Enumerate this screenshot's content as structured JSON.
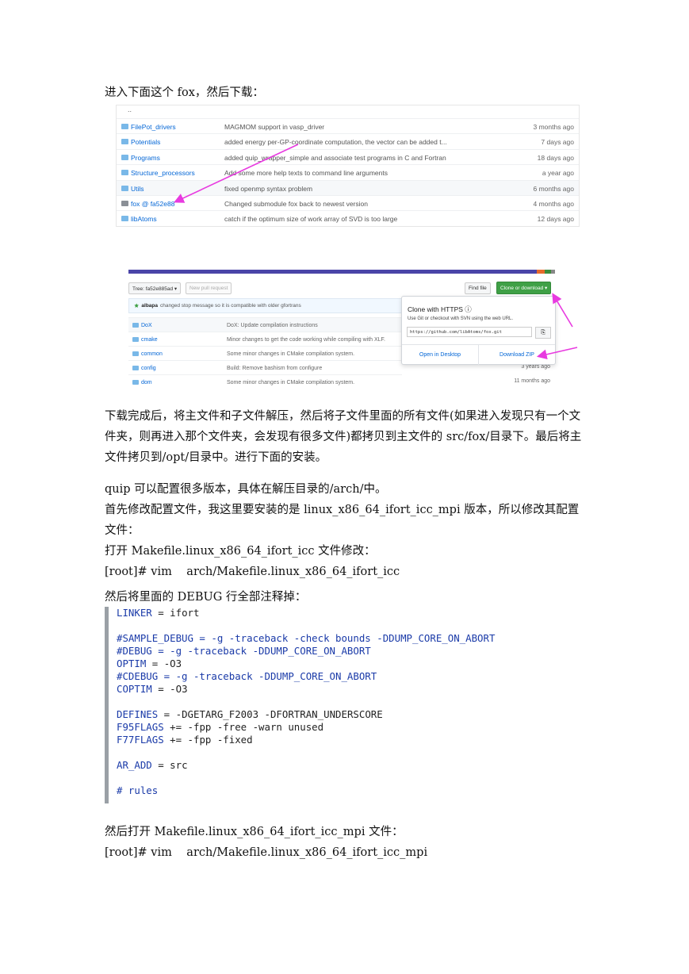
{
  "intro": "进入下面这个 fox，然后下载：",
  "file_list": {
    "parent": "..",
    "rows": [
      {
        "name": "FilePot_drivers",
        "message": "MAGMOM support in vasp_driver",
        "age": "3 months ago"
      },
      {
        "name": "Potentials",
        "message": "added energy per-GP-coordinate computation, the vector can be added t...",
        "age": "7 days ago"
      },
      {
        "name": "Programs",
        "message": "added quip_wrapper_simple and associate test programs in C and Fortran",
        "age": "18 days ago"
      },
      {
        "name": "Structure_processors",
        "message": "Add some more help texts to command line arguments",
        "age": "a year ago"
      },
      {
        "name": "Utils",
        "message": "fixed openmp syntax problem",
        "age": "6 months ago"
      },
      {
        "name": "fox @ fa52e88",
        "message": "Changed submodule fox back to newest version",
        "age": "4 months ago"
      },
      {
        "name": "libAtoms",
        "message": "catch if the optimum size of work array of SVD is too large",
        "age": "12 days ago"
      }
    ]
  },
  "repo": {
    "tree_button": "Tree: fa52e885ad ▾",
    "pull_button": "New pull request",
    "find_button": "Find file",
    "clone_button": "Clone or download ▾",
    "commit_user": "albapa",
    "commit_message": "changed stop message so it is compatible with older gfortrans",
    "rows": [
      {
        "name": "DoX",
        "message": "DoX: Update compilation instructions"
      },
      {
        "name": "cmake",
        "message": "Minor changes to get the code working while compiling with XLF."
      },
      {
        "name": "common",
        "message": "Some minor changes in CMake compilation system."
      },
      {
        "name": "config",
        "message": "Build: Remove bashism from configure"
      },
      {
        "name": "dom",
        "message": "Some minor changes in CMake compilation system."
      }
    ],
    "ages": [
      "3 years ago",
      "11 months ago"
    ],
    "popup": {
      "title": "Clone with HTTPS ⓘ",
      "subtitle": "Use Git or checkout with SVN using the web URL.",
      "url": "https://github.com/libAtoms/fox.git",
      "open_desktop": "Open in Desktop",
      "download_zip": "Download ZIP"
    }
  },
  "paragraph2": "下载完成后，将主文件和子文件解压，然后将子文件里面的所有文件(如果进入发现只有一个文件夹，则再进入那个文件夹，会发现有很多文件)都拷贝到主文件的 src/fox/目录下。最后将主文件拷贝到/opt/目录中。进行下面的安装。",
  "lines": [
    "quip 可以配置很多版本，具体在解压目录的/arch/中。",
    "首先修改配置文件，我这里要安装的是 linux_x86_64_ifort_icc_mpi 版本，所以修改其配置文件：",
    "打开 Makefile.linux_x86_64_ifort_icc 文件修改：",
    "[root]# vim    arch/Makefile.linux_x86_64_ifort_icc"
  ],
  "line_before_code": "然后将里面的 DEBUG 行全部注释掉：",
  "code_lines": [
    {
      "k": "LINKER",
      "o": " = ",
      "v": "ifort"
    },
    {
      "k": "",
      "o": "",
      "v": ""
    },
    {
      "k": "#SAMPLE_DEBUG = -g -traceback -check bounds -DDUMP_CORE_ON_ABORT",
      "o": "",
      "v": ""
    },
    {
      "k": "#DEBUG = -g -traceback -DDUMP_CORE_ON_ABORT",
      "o": "",
      "v": ""
    },
    {
      "k": "OPTIM",
      "o": " = ",
      "v": "-O3"
    },
    {
      "k": "#CDEBUG = -g -traceback -DDUMP_CORE_ON_ABORT",
      "o": "",
      "v": ""
    },
    {
      "k": "COPTIM",
      "o": " = ",
      "v": "-O3"
    },
    {
      "k": "",
      "o": "",
      "v": ""
    },
    {
      "k": "DEFINES",
      "o": " = ",
      "v": "-DGETARG_F2003 -DFORTRAN_UNDERSCORE"
    },
    {
      "k": "F95FLAGS",
      "o": " += ",
      "v": "-fpp -free -warn unused"
    },
    {
      "k": "F77FLAGS",
      "o": " += ",
      "v": "-fpp -fixed"
    },
    {
      "k": "",
      "o": "",
      "v": ""
    },
    {
      "k": "AR_ADD",
      "o": " = ",
      "v": "src"
    },
    {
      "k": "",
      "o": "",
      "v": ""
    },
    {
      "k": "# rules",
      "o": "",
      "v": ""
    }
  ],
  "end_lines": [
    "然后打开 Makefile.linux_x86_64_ifort_icc_mpi 文件：",
    "[root]# vim    arch/Makefile.linux_x86_64_ifort_icc_mpi"
  ],
  "colors": {
    "arrow": "#e83ae0",
    "link": "#0366d6",
    "green": "#3fa046"
  }
}
